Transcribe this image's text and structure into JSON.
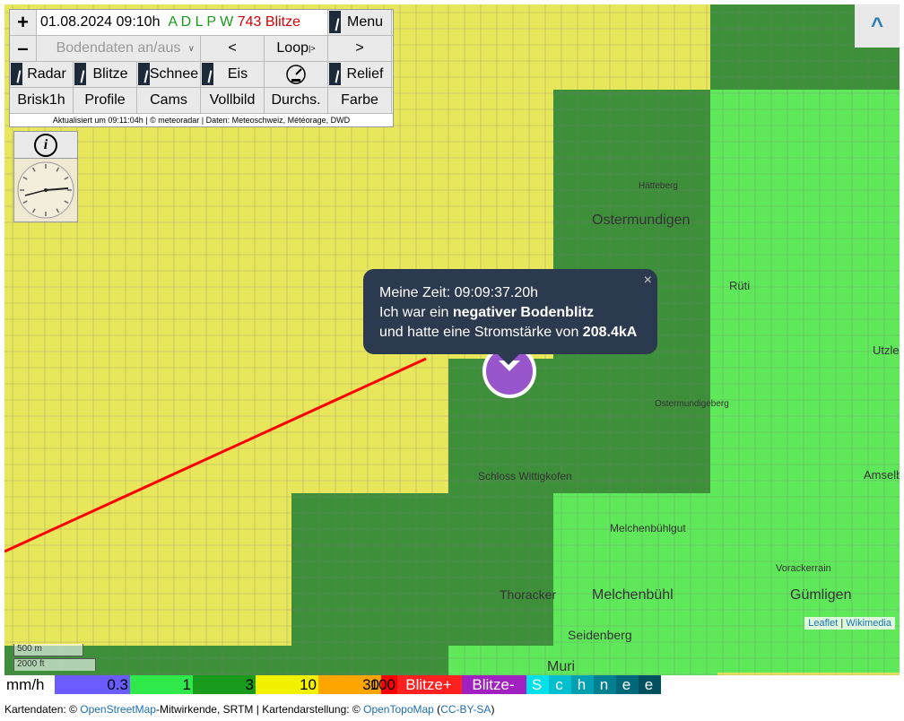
{
  "controls": {
    "zoom_in": "+",
    "zoom_out": "–",
    "datetime": "01.08.2024 09:10h",
    "sources": "A D L P W",
    "strike_count": "743 Blitze",
    "menu": "Menu",
    "ground_data": "Bodendaten an/aus",
    "prev": "<",
    "loop": "Loop",
    "loop_mark": "|>",
    "next": ">",
    "radar": "Radar",
    "blitze": "Blitze",
    "schnee": "Schnee",
    "eis": "Eis",
    "relief": "Relief",
    "brisk": "Brisk1h",
    "profile": "Profile",
    "cams": "Cams",
    "vollbild": "Vollbild",
    "durchs": "Durchs.",
    "farbe": "Farbe",
    "updated": "Aktualisiert um 09:11:04h | © meteoradar | Daten: Meteoschweiz, Météorage, DWD",
    "info": "i"
  },
  "top_right": "^",
  "popup": {
    "line1": "Meine Zeit: 09:09:37.20h",
    "line2_pre": "Ich war ein ",
    "line2_bold": "negativer Bodenblitz",
    "line3_pre": "und hatte eine Stromstärke von ",
    "line3_bold": "208.4kA",
    "close": "×"
  },
  "map_labels": {
    "ostermundigen": "Ostermundigen",
    "ruti": "Rüti",
    "utzlen": "Utzlen",
    "schloss": "Schloss Wittigkofen",
    "ostermundigeberg": "Ostermundigeberg",
    "melchenbuhlgut": "Melchenbühlgut",
    "gumligen": "Gümligen",
    "vorackerrain": "Vorackerrain",
    "melchenbuhl": "Melchenbühl",
    "thoracker": "Thoracker",
    "seidenberg": "Seidenberg",
    "muri": "Muri",
    "amselberg": "Amselbe",
    "hatteberg": "Hätteberg"
  },
  "scale": {
    "metric": "500 m",
    "imperial": "2000 ft"
  },
  "attribution": {
    "leaflet": "Leaflet",
    "sep": " | ",
    "wikimedia": "Wikimedia"
  },
  "legend": {
    "unit": "mm/h",
    "items": [
      {
        "label": "0.3",
        "color": "#6a5cff"
      },
      {
        "label": "1",
        "color": "#2fe84a"
      },
      {
        "label": "3",
        "color": "#199b1e"
      },
      {
        "label": "10",
        "color": "#f2f200"
      },
      {
        "label": "30",
        "color": "#ffa500"
      },
      {
        "label": "100",
        "color": "#ff0000"
      },
      {
        "label": "Blitze+",
        "color": "#ff2020"
      },
      {
        "label": "Blitze-",
        "color": "#a020c0"
      }
    ],
    "snow": [
      "S",
      "c",
      "h",
      "n",
      "e",
      "e"
    ]
  },
  "footer": {
    "pre": "Kartendaten: © ",
    "osm": "OpenStreetMap",
    "mid": "-Mitwirkende, SRTM | Kartendarstellung: © ",
    "otm": "OpenTopoMap",
    "paren_open": " (",
    "license": "CC-BY-SA",
    "paren_close": ")"
  },
  "colors": {
    "yellow": "#e8e65a",
    "green_light": "#5fe85a",
    "green_dark": "#3e8f3a",
    "popup_bg": "#2b3a4e",
    "marker": "#9955cc",
    "source_text": "#1a9a1a",
    "strike_text": "#d40000"
  }
}
